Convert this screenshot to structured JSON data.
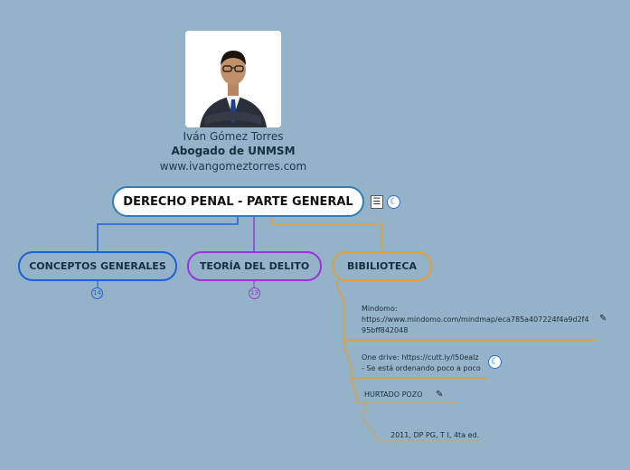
{
  "profile": {
    "name": "Iván Gómez Torres",
    "title": "Abogado de UNMSM",
    "website": "www.ivangomeztorres.com"
  },
  "central_topic": {
    "label": "DERECHO PENAL - PARTE GENERAL"
  },
  "topics": [
    {
      "label": "CONCEPTOS GENERALES",
      "count": "14",
      "color": "#1f62d6"
    },
    {
      "label": "TEORÍA DEL DELITO",
      "count": "13",
      "color": "#9b35d6"
    },
    {
      "label": "BIBILIOTECA",
      "color": "#dfa13a"
    }
  ],
  "biblioteca": {
    "mindomo_label": "Mindomo:",
    "mindomo_url_1": "https://www.mindomo.com/mindmap/eca785a407224f4a9d2f4",
    "mindomo_url_2": "95bff842048",
    "drive_line_1": "One drive: https://cutt.ly/l50ealz",
    "drive_line_2": "- Se está ordenando poco a poco",
    "hurtado_label": "HURTADO POZO",
    "hurtado_child": "2011, DP PG, T I, 4ta ed."
  },
  "icons": {
    "menu": "menu-icon",
    "moon": "moon-icon",
    "pen": "pen-icon"
  },
  "colors": {
    "background": "#94b2c8",
    "central_border": "#2d7fb8",
    "biblioteca_line": "#dfa13a"
  }
}
